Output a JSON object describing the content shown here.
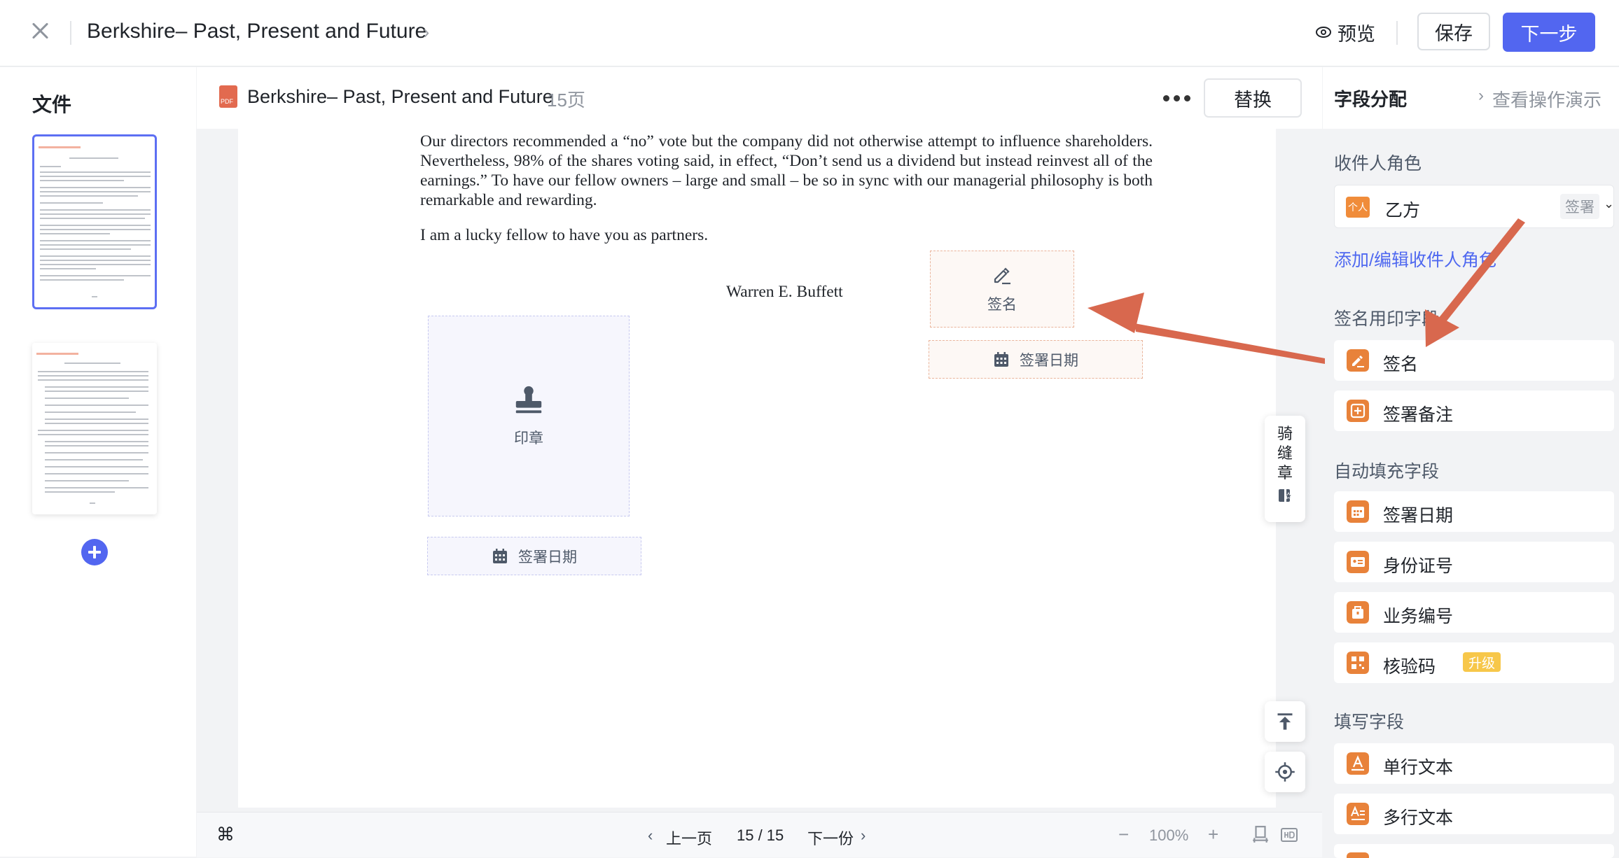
{
  "header": {
    "title": "Berkshire– Past, Present and Future",
    "preview_label": "预览",
    "save_label": "保存",
    "next_label": "下一步"
  },
  "left_panel": {
    "title": "文件"
  },
  "center": {
    "doc_title": "Berkshire– Past, Present and Future",
    "pages_label": "15页",
    "replace_label": "替换",
    "pdf_badge": "PDF",
    "doc_paragraph": "Our directors recommended a “no” vote but the company did not otherwise attempt to influence shareholders. Nevertheless, 98% of the shares voting said, in effect, “Don’t send us a dividend but instead reinvest all of the earnings.” To have our fellow owners – large and small – be so in sync with our managerial philosophy is both remarkable and rewarding.",
    "doc_line2": "I am a lucky fellow to have you as partners.",
    "signer_name": "Warren E. Buffett",
    "fields": {
      "signature": "签名",
      "sign_date": "签署日期",
      "stamp": "印章",
      "stamp_date": "签署日期"
    },
    "qifeng_label": "骑缝章"
  },
  "bottom_bar": {
    "shortcut_icon": "⌘",
    "prev_label": "上一页",
    "page_indicator": "15 / 15",
    "next_label": "下一份",
    "zoom": "100%"
  },
  "right_panel": {
    "title": "字段分配",
    "demo_link": "查看操作演示",
    "recipient_role_label": "收件人角色",
    "recipient": {
      "badge": "个人",
      "name": "乙方",
      "sign_type": "签署"
    },
    "add_recipient_label": "添加/编辑收件人角色",
    "sections": {
      "signature_fields": "签名用印字段",
      "auto_fields": "自动填充字段",
      "fill_fields": "填写字段"
    },
    "signature_items": [
      {
        "label": "签名",
        "icon": "signature-pen-icon"
      },
      {
        "label": "签署备注",
        "icon": "note-plus-icon"
      }
    ],
    "auto_items": [
      {
        "label": "签署日期",
        "icon": "calendar-icon"
      },
      {
        "label": "身份证号",
        "icon": "id-card-icon"
      },
      {
        "label": "业务编号",
        "icon": "business-number-icon"
      },
      {
        "label": "核验码",
        "icon": "qr-code-icon",
        "badge": "升级"
      }
    ],
    "fill_items": [
      {
        "label": "单行文本",
        "icon": "single-line-text-icon"
      },
      {
        "label": "多行文本",
        "icon": "multi-line-text-icon"
      }
    ]
  },
  "colors": {
    "primary": "#5266f0",
    "field_orange": "#e8823a",
    "arrow": "#d8684e",
    "upgrade": "#f7c74a"
  }
}
